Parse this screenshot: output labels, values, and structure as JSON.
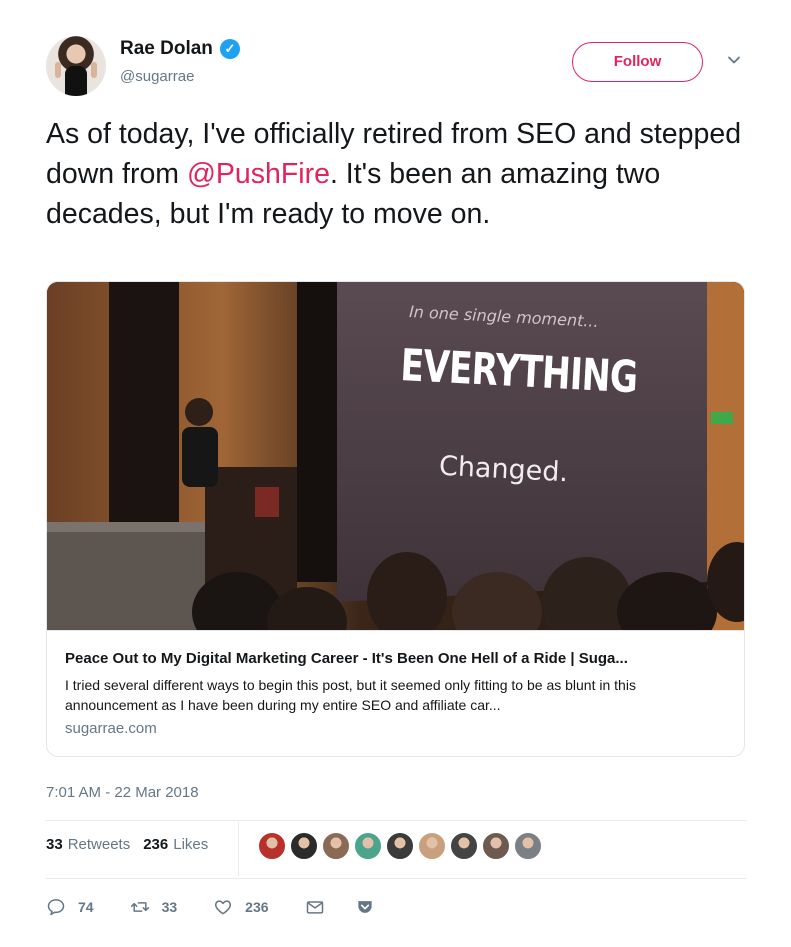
{
  "author": {
    "name": "Rae Dolan",
    "handle": "@sugarrae",
    "verified_icon": "✓"
  },
  "follow_label": "Follow",
  "tweet": {
    "text_before": "As of today, I've officially retired from SEO and stepped down from ",
    "mention": "@PushFire",
    "text_after": ". It's been an amazing two decades, but I'm ready to move on."
  },
  "card": {
    "slide_line1": "In one single moment...",
    "slide_line2": "EVERYTHING",
    "slide_line3": "Changed.",
    "title": "Peace Out to My Digital Marketing Career - It's Been One Hell of a Ride | Suga...",
    "description": "I tried several different ways to begin this post, but it seemed only fitting to be as blunt in this announcement as I have been during my entire SEO and affiliate car...",
    "domain": "sugarrae.com"
  },
  "timestamp": "7:01 AM - 22 Mar 2018",
  "stats": {
    "retweets_count": "33",
    "retweets_label": "Retweets",
    "likes_count": "236",
    "likes_label": "Likes"
  },
  "likers_colors": [
    "#b8322b",
    "#2b2b2b",
    "#8a6a55",
    "#4aa58c",
    "#3b3b3b",
    "#c9a07d",
    "#444444",
    "#6d5b4f",
    "#7b7f86"
  ],
  "actions": {
    "reply_count": "74",
    "retweet_count": "33",
    "like_count": "236"
  },
  "colors": {
    "accent": "#e0245e",
    "verified": "#1da1f2",
    "muted": "#657786"
  }
}
